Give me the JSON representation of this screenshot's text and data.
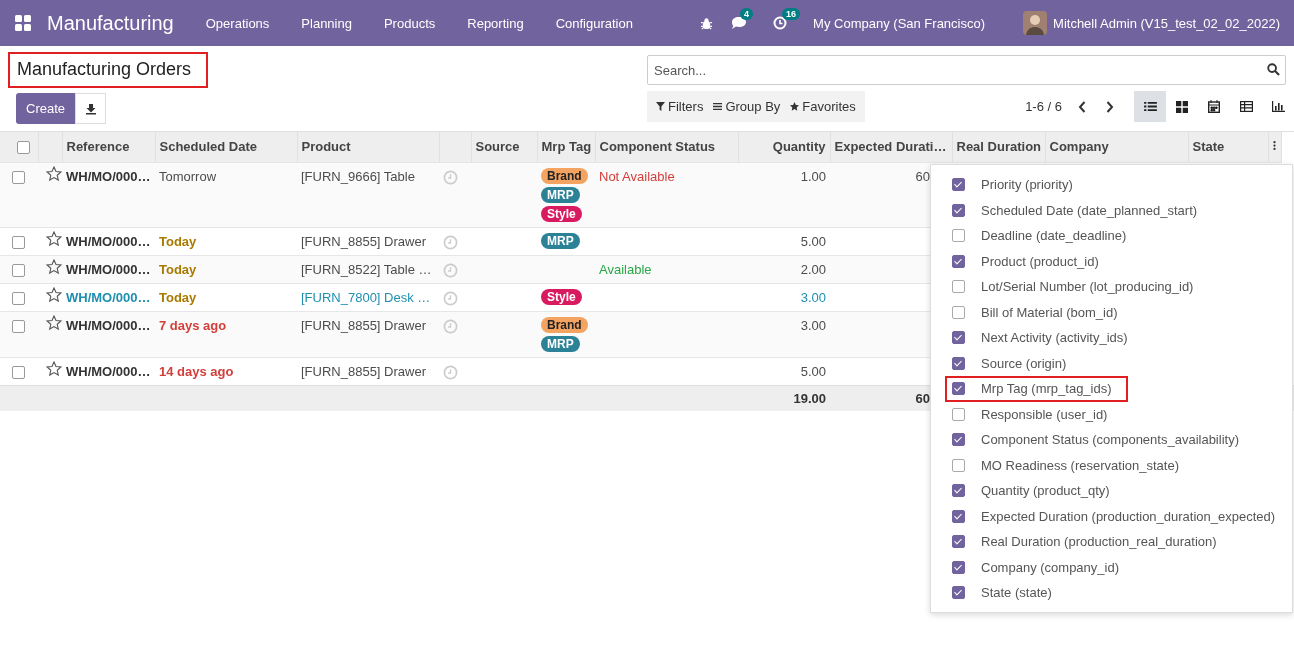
{
  "navbar": {
    "app_name": "Manufacturing",
    "menus": [
      "Operations",
      "Planning",
      "Products",
      "Reporting",
      "Configuration"
    ],
    "messages_count": "4",
    "activities_count": "16",
    "company": "My Company (San Francisco)",
    "user": "Mitchell Admin (V15_test_02_02_2022)"
  },
  "control_panel": {
    "title": "Manufacturing Orders",
    "title_highlighted": true,
    "create_button": "Create",
    "search": {
      "placeholder": "Search..."
    },
    "filters": "Filters",
    "group_by": "Group By",
    "favorites": "Favorites",
    "pager": "1-6 / 6",
    "views": [
      {
        "kind": "list",
        "selected": true
      },
      {
        "kind": "kanban",
        "selected": false
      },
      {
        "kind": "calendar",
        "selected": false
      },
      {
        "kind": "pivot",
        "selected": false
      },
      {
        "kind": "graph",
        "selected": false
      }
    ]
  },
  "table": {
    "all_selected": false,
    "columns": [
      {
        "kind": "check"
      },
      {
        "kind": "star"
      },
      {
        "label": "Reference",
        "kind": "text"
      },
      {
        "label": "Scheduled Date",
        "kind": "text"
      },
      {
        "label": "Product",
        "kind": "text"
      },
      {
        "kind": "activity"
      },
      {
        "label": "Source",
        "kind": "text"
      },
      {
        "label": "Mrp Tag",
        "kind": "text"
      },
      {
        "label": "Component Status",
        "kind": "text"
      },
      {
        "label": "Quantity",
        "kind": "num"
      },
      {
        "label": "Expected Durati…",
        "kind": "num"
      },
      {
        "label": "Real Duration",
        "kind": "text"
      },
      {
        "label": "Company",
        "kind": "text"
      },
      {
        "label": "State",
        "kind": "text"
      }
    ],
    "rows": [
      {
        "selected": false,
        "reference": "WH/MO/000…",
        "date": "Tomorrow",
        "today": false,
        "late": false,
        "product": "[FURN_9666] Table",
        "tags": [
          {
            "label": "Brand",
            "color": "#f4a460"
          },
          {
            "label": "MRP",
            "color": "#2b8196"
          },
          {
            "label": "Style",
            "color": "#d81b60"
          }
        ],
        "component_status": {
          "text": "Not Available",
          "available": false
        },
        "quantity": "1.00",
        "expected": "60",
        "highlighted": false
      },
      {
        "selected": false,
        "reference": "WH/MO/000…",
        "date": "Today",
        "today": true,
        "late": false,
        "product": "[FURN_8855] Drawer",
        "tags": [
          {
            "label": "MRP",
            "color": "#2b8196"
          }
        ],
        "quantity": "5.00",
        "highlighted": false
      },
      {
        "selected": false,
        "reference": "WH/MO/000…",
        "date": "Today",
        "today": true,
        "late": false,
        "product": "[FURN_8522] Table …",
        "tags": [],
        "component_status": {
          "text": "Available",
          "available": true
        },
        "quantity": "2.00",
        "highlighted": false
      },
      {
        "selected": false,
        "reference": "WH/MO/000…",
        "date": "Today",
        "today": true,
        "late": false,
        "product": "[FURN_7800] Desk …",
        "tags": [
          {
            "label": "Style",
            "color": "#d81b60"
          }
        ],
        "quantity": "3.00",
        "highlighted": true
      },
      {
        "selected": false,
        "reference": "WH/MO/000…",
        "date": "7 days ago",
        "today": false,
        "late": true,
        "product": "[FURN_8855] Drawer",
        "tags": [
          {
            "label": "Brand",
            "color": "#f4a460"
          },
          {
            "label": "MRP",
            "color": "#2b8196"
          }
        ],
        "quantity": "3.00",
        "highlighted": false
      },
      {
        "selected": false,
        "reference": "WH/MO/000…",
        "date": "14 days ago",
        "today": false,
        "late": true,
        "product": "[FURN_8855] Drawer",
        "tags": [],
        "quantity": "5.00",
        "highlighted": false
      }
    ],
    "totals": {
      "quantity": "19.00",
      "expected": "60"
    }
  },
  "optional_columns": [
    {
      "label": "Priority (priority)",
      "checked": true,
      "highlighted": false
    },
    {
      "label": "Scheduled Date (date_planned_start)",
      "checked": true,
      "highlighted": false
    },
    {
      "label": "Deadline (date_deadline)",
      "checked": false,
      "highlighted": false
    },
    {
      "label": "Product (product_id)",
      "checked": true,
      "highlighted": false
    },
    {
      "label": "Lot/Serial Number (lot_producing_id)",
      "checked": false,
      "highlighted": false
    },
    {
      "label": "Bill of Material (bom_id)",
      "checked": false,
      "highlighted": false
    },
    {
      "label": "Next Activity (activity_ids)",
      "checked": true,
      "highlighted": false
    },
    {
      "label": "Source (origin)",
      "checked": true,
      "highlighted": false
    },
    {
      "label": "Mrp Tag (mrp_tag_ids)",
      "checked": true,
      "highlighted": true
    },
    {
      "label": "Responsible (user_id)",
      "checked": false,
      "highlighted": false
    },
    {
      "label": "Component Status (components_availability)",
      "checked": true,
      "highlighted": false
    },
    {
      "label": "MO Readiness (reservation_state)",
      "checked": false,
      "highlighted": false
    },
    {
      "label": "Quantity (product_qty)",
      "checked": true,
      "highlighted": false
    },
    {
      "label": "Expected Duration (production_duration_expected)",
      "checked": true,
      "highlighted": false
    },
    {
      "label": "Real Duration (production_real_duration)",
      "checked": true,
      "highlighted": false
    },
    {
      "label": "Company (company_id)",
      "checked": true,
      "highlighted": false
    },
    {
      "label": "State (state)",
      "checked": true,
      "highlighted": false
    }
  ]
}
